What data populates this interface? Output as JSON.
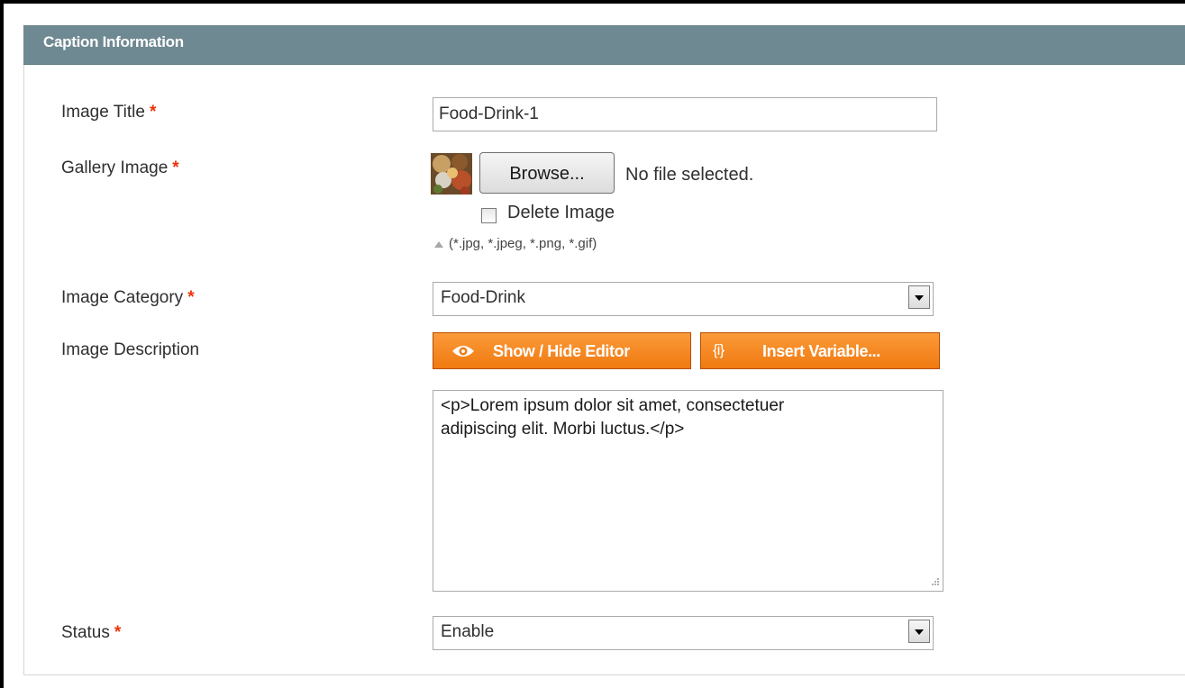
{
  "section": {
    "title": "Caption Information"
  },
  "required_marker": "*",
  "fields": {
    "image_title": {
      "label": "Image Title",
      "value": "Food-Drink-1"
    },
    "gallery_image": {
      "label": "Gallery Image",
      "browse_label": "Browse...",
      "file_status": "No file selected.",
      "delete_label": "Delete Image",
      "delete_checked": false,
      "note": "(*.jpg, *.jpeg, *.png, *.gif)"
    },
    "image_category": {
      "label": "Image Category",
      "value": "Food-Drink"
    },
    "image_description": {
      "label": "Image Description",
      "show_hide_label": "Show / Hide Editor",
      "insert_variable_label": "Insert Variable...",
      "insert_variable_icon": "{i}",
      "value": "<p>Lorem ipsum dolor sit amet, consectetuer\nadipiscing elit. Morbi luctus.</p>"
    },
    "status": {
      "label": "Status",
      "value": "Enable"
    }
  },
  "colors": {
    "header_bg": "#6f8992",
    "button_orange": "#f48a24",
    "required": "#eb340a"
  },
  "icons": {
    "select_arrow": "chevron-down-icon",
    "show_hide": "eye-icon",
    "insert_variable": "variable-icon",
    "note": "triangle-up-icon",
    "thumbnail": "food-thumbnail-image"
  }
}
